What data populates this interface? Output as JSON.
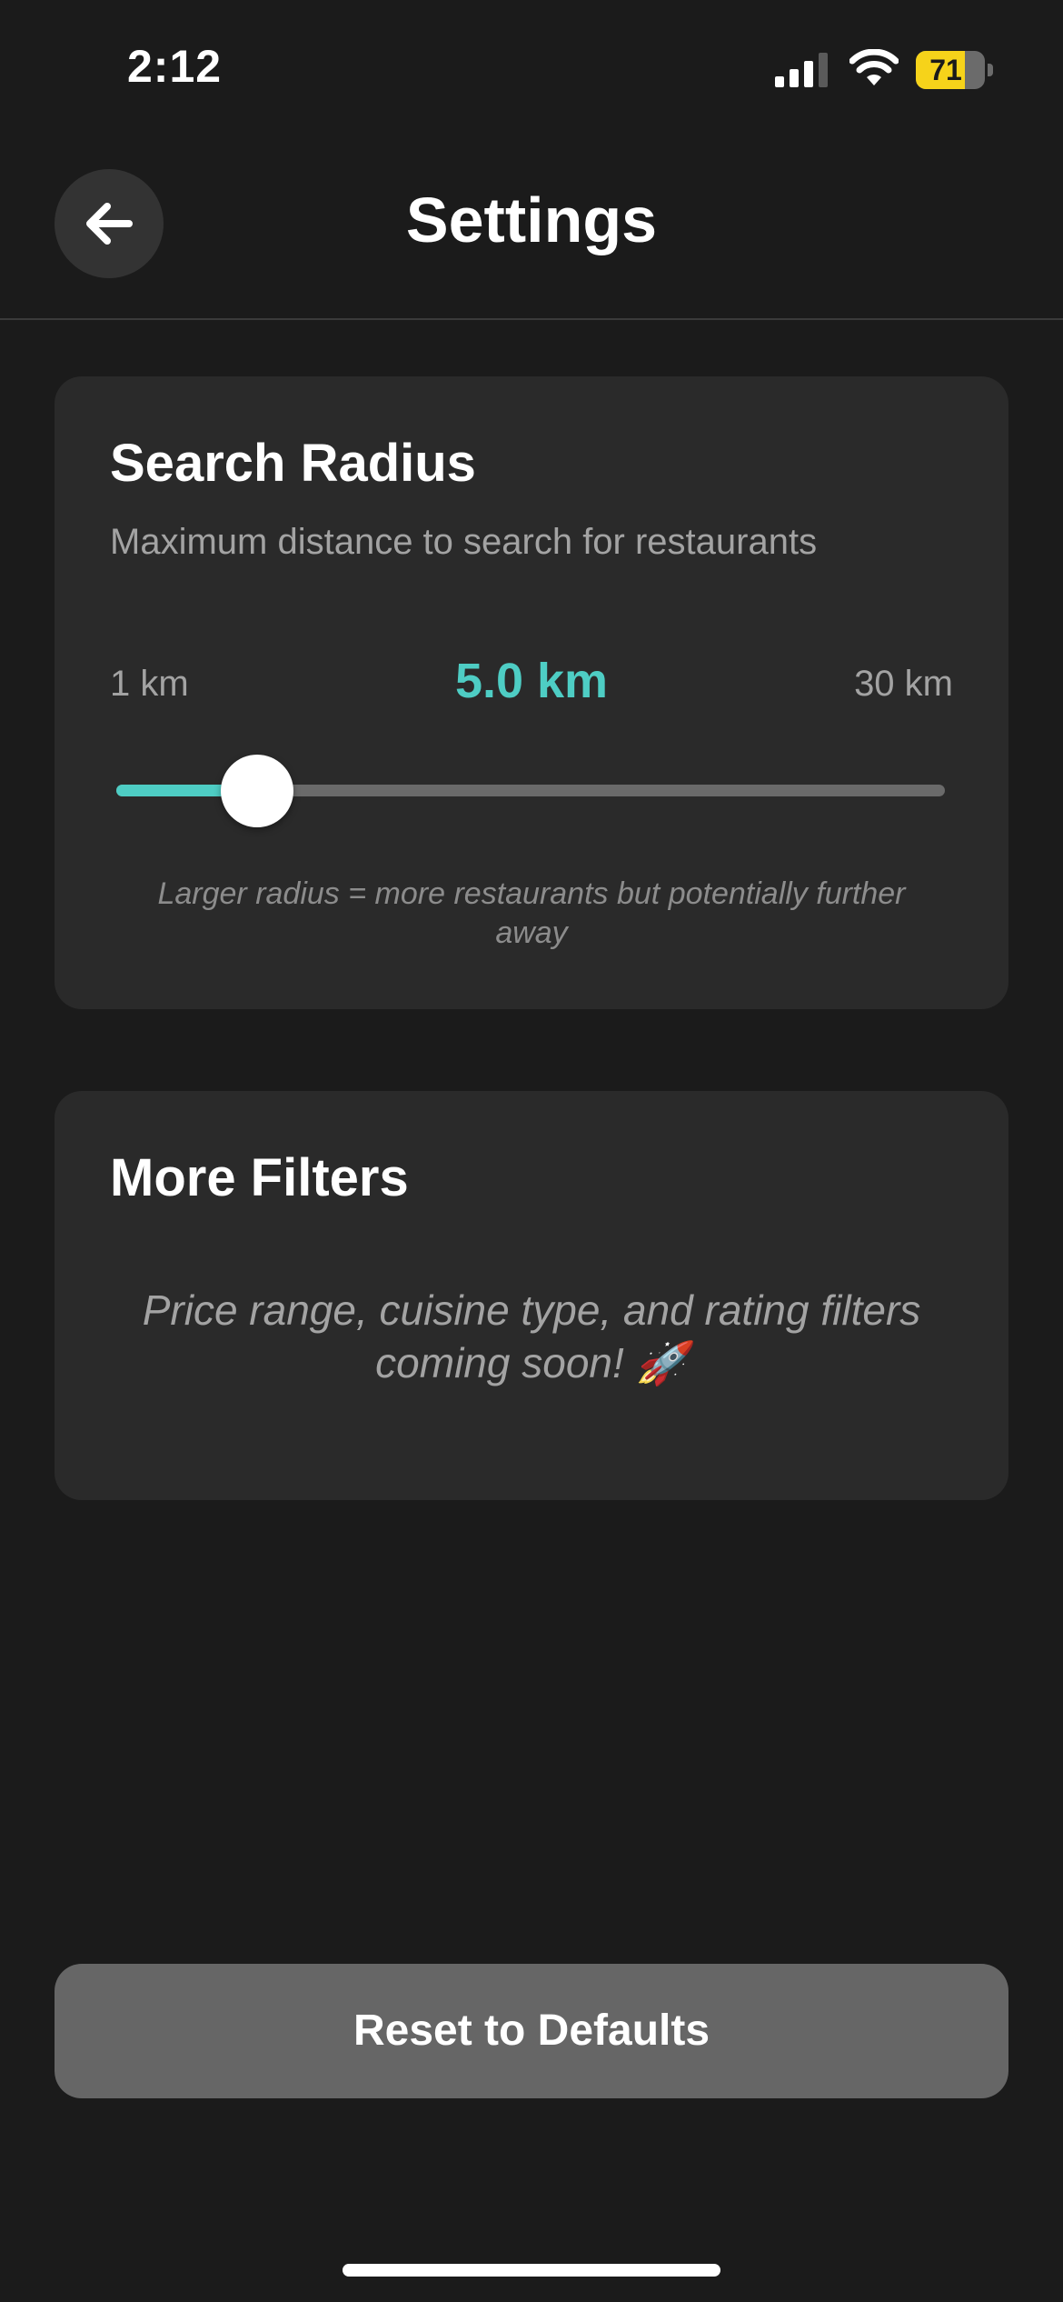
{
  "status_bar": {
    "time": "2:12",
    "battery_percent": "71",
    "battery_level": 0.71,
    "signal_icon": "cellular-signal-icon",
    "wifi_icon": "wifi-icon"
  },
  "header": {
    "title": "Settings",
    "back_icon": "arrow-left-icon"
  },
  "search_radius": {
    "title": "Search Radius",
    "description": "Maximum distance to search for restaurants",
    "min_label": "1 km",
    "max_label": "30 km",
    "value_label": "5.0 km",
    "min_value": 1,
    "max_value": 30,
    "value": 5.0,
    "hint": "Larger radius = more restaurants but potentially further away"
  },
  "more_filters": {
    "title": "More Filters",
    "message": "Price range, cuisine type, and rating filters coming soon! 🚀"
  },
  "reset_button": {
    "label": "Reset to Defaults"
  },
  "colors": {
    "background": "#1b1b1b",
    "card": "#2a2a2a",
    "accent": "#4ecdc4",
    "battery": "#f6d31a",
    "button": "#666666"
  }
}
